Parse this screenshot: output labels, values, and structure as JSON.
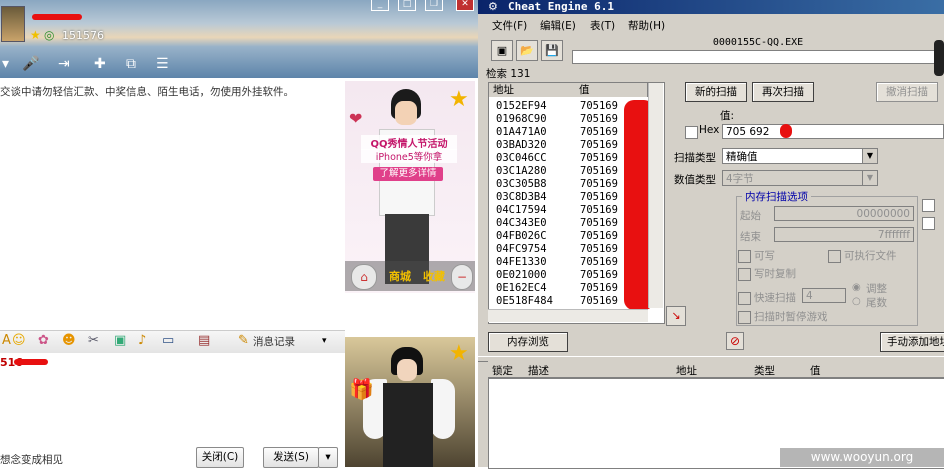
{
  "qq": {
    "number": "151576",
    "toolbar_icons": [
      "avatar-icon",
      "mic-icon",
      "transfer-icon",
      "share-icon",
      "menu-icon"
    ],
    "warning": "交谈中请勿轻信汇款、中奖信息、陌生电话，勿使用外挂软件。",
    "ad1": {
      "title": "QQ秀情人节活动",
      "subtitle": "iPhone5等你拿",
      "button": "了解更多详情",
      "home_label": "🏠",
      "shop_label": "商城",
      "fav_label": "收藏"
    },
    "msg_log_label": "消息记录",
    "input_prefix": "516",
    "status_text": "想念变成相见",
    "close_label": "关闭(C)",
    "send_label": "发送(S)"
  },
  "ce": {
    "title": "Cheat Engine 6.1",
    "menu": [
      "文件(F)",
      "编辑(E)",
      "表(T)",
      "帮助(H)"
    ],
    "process": "0000155C-QQ.EXE",
    "found_label": "检索",
    "found_count": "131",
    "col_address": "地址",
    "col_value": "值",
    "rows": [
      {
        "address": "0152EF94",
        "value": "705169"
      },
      {
        "address": "01968C90",
        "value": "705169"
      },
      {
        "address": "01A471A0",
        "value": "705169"
      },
      {
        "address": "03BAD320",
        "value": "705169"
      },
      {
        "address": "03C046CC",
        "value": "705169"
      },
      {
        "address": "03C1A280",
        "value": "705169"
      },
      {
        "address": "03C305B8",
        "value": "705169"
      },
      {
        "address": "03C8D3B4",
        "value": "705169"
      },
      {
        "address": "04C17594",
        "value": "705169"
      },
      {
        "address": "04C343E0",
        "value": "705169"
      },
      {
        "address": "04FB026C",
        "value": "705169"
      },
      {
        "address": "04FC9754",
        "value": "705169"
      },
      {
        "address": "04FE1330",
        "value": "705169"
      },
      {
        "address": "0E021000",
        "value": "705169"
      },
      {
        "address": "0E162EC4",
        "value": "705169"
      },
      {
        "address": "0E518F484",
        "value": "705169"
      }
    ],
    "new_scan": "新的扫描",
    "next_scan": "再次扫描",
    "undo_scan": "撤消扫描",
    "value_label": "值:",
    "hex_label": "Hex",
    "value_input": "705 692",
    "scan_type_label": "扫描类型",
    "scan_type_value": "精确值",
    "value_type_label": "数值类型",
    "value_type_value": "4字节",
    "mem_options": "内存扫描选项",
    "start_label": "起始",
    "start_value": "00000000",
    "end_label": "结束",
    "end_value": "7fffffff",
    "writable": "可写",
    "executable": "可执行文件",
    "copy_on_write": "写时复制",
    "fast_scan": "快速扫描",
    "fast_scan_value": "4",
    "align": "调整",
    "last_digits": "尾数",
    "pause_scan": "扫描时暂停游戏",
    "mem_view": "内存浏览",
    "manual_add": "手动添加地址",
    "list_cols": [
      "锁定",
      "描述",
      "地址",
      "类型",
      "值"
    ]
  },
  "watermark": "www.wooyun.org"
}
